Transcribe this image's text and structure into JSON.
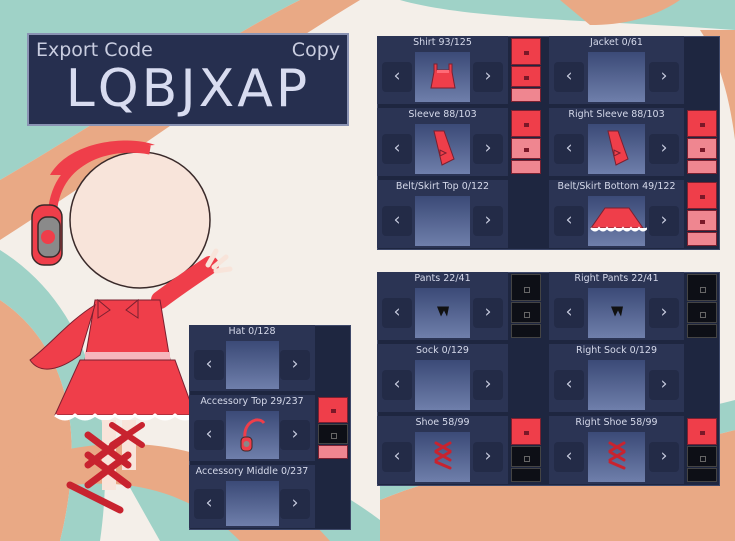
{
  "export": {
    "label": "Export Code",
    "copy": "Copy",
    "code": "LQBJXAP"
  },
  "colors": {
    "red": "#ef3e4a",
    "pink": "#ef8690",
    "panel": "#1e2640",
    "dark": "#0d0f16"
  },
  "slots": {
    "shirt": {
      "title": "Shirt 93/125",
      "has_item": true
    },
    "jacket": {
      "title": "Jacket 0/61",
      "has_item": false
    },
    "sleeve": {
      "title": "Sleeve 88/103",
      "has_item": true
    },
    "right_sleeve": {
      "title": "Right Sleeve 88/103",
      "has_item": true
    },
    "belt_top": {
      "title": "Belt/Skirt Top 0/122",
      "has_item": false
    },
    "belt_bottom": {
      "title": "Belt/Skirt Bottom 49/122",
      "has_item": true
    },
    "hat": {
      "title": "Hat 0/128",
      "has_item": false
    },
    "accessory_top": {
      "title": "Accessory Top 29/237",
      "has_item": true
    },
    "accessory_middle": {
      "title": "Accessory Middle 0/237",
      "has_item": false
    },
    "pants": {
      "title": "Pants 22/41",
      "has_item": true
    },
    "right_pants": {
      "title": "Right Pants 22/41",
      "has_item": true
    },
    "sock": {
      "title": "Sock 0/129",
      "has_item": false
    },
    "right_sock": {
      "title": "Right Sock 0/129",
      "has_item": false
    },
    "shoe": {
      "title": "Shoe 58/99",
      "has_item": true
    },
    "right_shoe": {
      "title": "Right Shoe 58/99",
      "has_item": true
    }
  },
  "arrows": {
    "left": "‹",
    "right": "›"
  },
  "icons": [
    "left-arrow-icon",
    "right-arrow-icon",
    "shirt-icon",
    "sleeve-icon",
    "skirt-icon",
    "headphones-icon",
    "pants-icon",
    "shoe-icon"
  ]
}
